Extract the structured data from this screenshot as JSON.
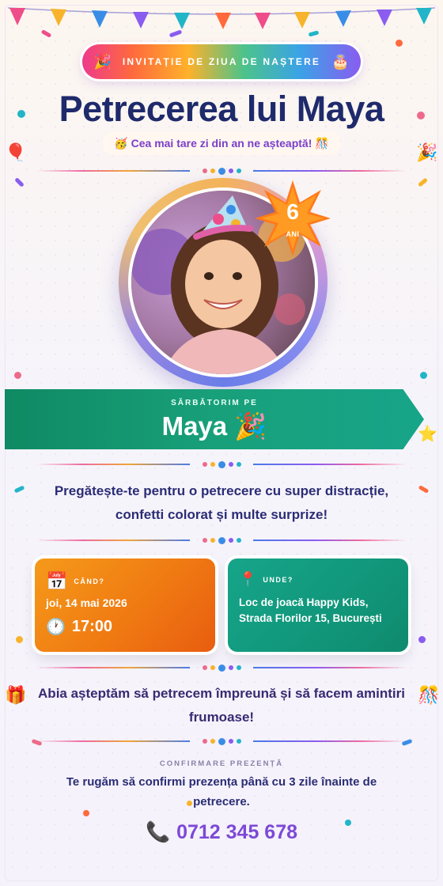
{
  "header": {
    "badge_left_emoji": "🎉",
    "badge_text": "INVITAȚIE DE ZIUA DE NAȘTERE",
    "badge_right_emoji": "🎂",
    "title": "Petrecerea lui Maya",
    "subtitle": "🥳 Cea mai tare zi din an ne așteaptă! 🎊"
  },
  "age_badge": {
    "number": "6",
    "unit": "ANI"
  },
  "ribbon": {
    "subtitle": "SĂRBĂTORIM PE",
    "name": "Maya 🎉"
  },
  "intro": {
    "line1": "Pregătește-te pentru o petrecere cu super distracție,",
    "line2": "confetti colorat și multe surprize!"
  },
  "when": {
    "icon": "📅",
    "label": "CÂND?",
    "date": "joi, 14 mai 2026",
    "time_icon": "🕐",
    "time": "17:00"
  },
  "where": {
    "icon": "📍",
    "label": "UNDE?",
    "line1": "Loc de joacă Happy Kids,",
    "line2": "Strada Florilor 15, București"
  },
  "closing": {
    "line1": "Abia așteptăm să petrecem împreună și să facem amintiri",
    "line2": "frumoase!"
  },
  "rsvp": {
    "label": "CONFIRMARE PREZENȚĂ",
    "line1": "Te rugăm să confirmi prezența până cu 3 zile înainte de",
    "line2": "petrecere.",
    "phone_icon": "📞",
    "phone": "0712 345 678"
  },
  "decor": {
    "balloon": "🎈",
    "party_popper": "🎉",
    "star": "⭐",
    "gift": "🎁",
    "confetti_ball": "🎊"
  },
  "colors": {
    "title": "#1e2a6b",
    "ribbon": "#0f8a63",
    "when_card": "#f07a12",
    "where_card": "#11967a",
    "phone": "#7c49d6"
  }
}
